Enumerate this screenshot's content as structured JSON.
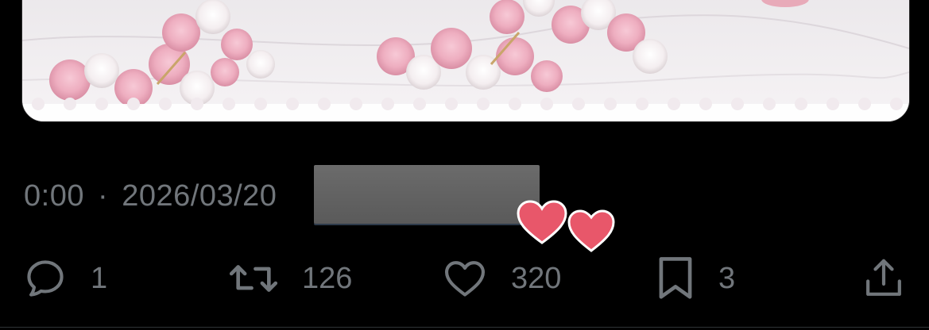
{
  "post": {
    "time": "0:00",
    "separator": "·",
    "date": "2026/03/20"
  },
  "actions": {
    "reply_count": "1",
    "repost_count": "126",
    "like_count": "320",
    "bookmark_count": "3"
  },
  "icons": {
    "reply": "reply-icon",
    "repost": "repost-icon",
    "like": "heart-icon",
    "bookmark": "bookmark-icon",
    "share": "share-icon"
  },
  "colors": {
    "background": "#000000",
    "muted_text": "#71767b",
    "sticker_heart": "#e8576a"
  }
}
